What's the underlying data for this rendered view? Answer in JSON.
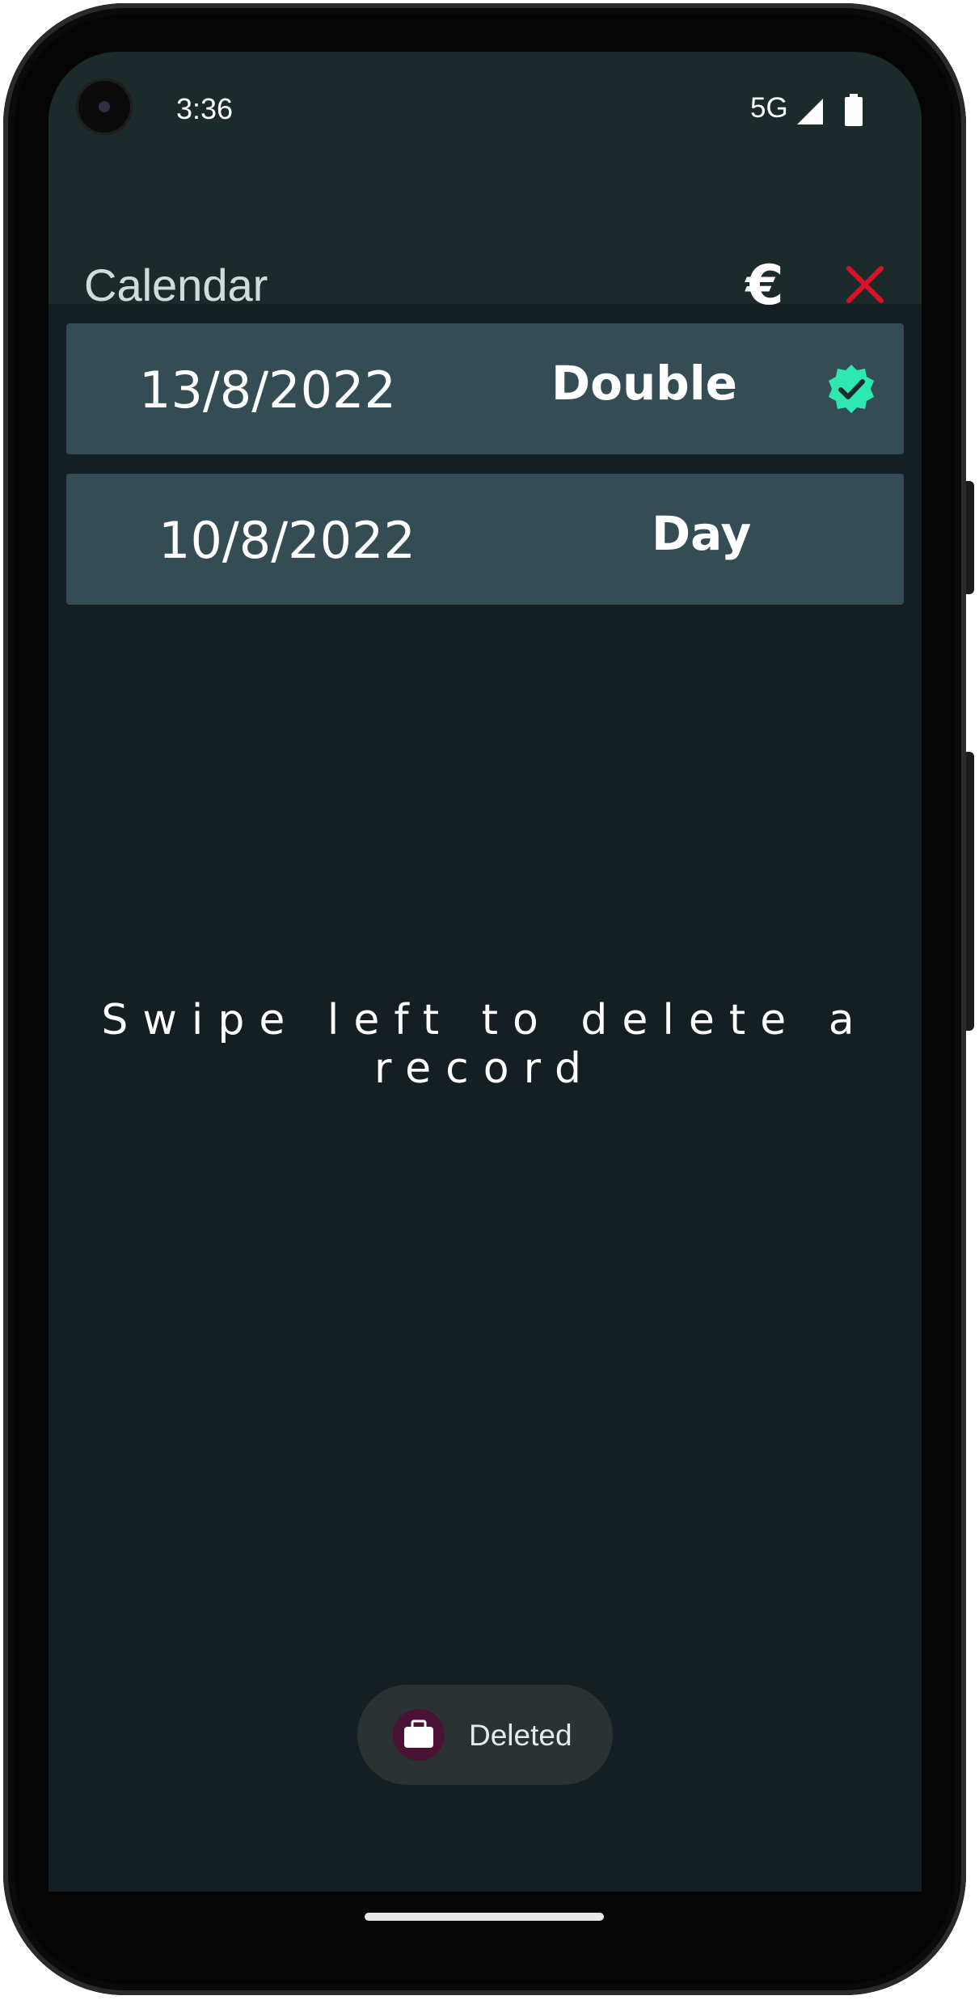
{
  "status_bar": {
    "time": "3:36",
    "network": "5G",
    "icons": [
      "signal-icon",
      "battery-icon"
    ]
  },
  "app_bar": {
    "title": "Calendar",
    "currency_symbol": "€",
    "currency_icon": "euro-icon",
    "close_icon": "close-icon",
    "close_color": "#d9102a"
  },
  "records": [
    {
      "date": "13/8/2022",
      "type": "Double",
      "verified": true,
      "status_icon": "verified-badge-icon",
      "status_color": "#2ee8b2"
    },
    {
      "date": "10/8/2022",
      "type": "Day",
      "verified": false
    }
  ],
  "hint": "Swipe left to delete a record",
  "toast": {
    "text": "Deleted",
    "icon": "briefcase-icon",
    "icon_bg": "#4a1333"
  },
  "colors": {
    "background": "#151e22",
    "app_bar": "#1b2a2a",
    "card": "#344c54"
  }
}
